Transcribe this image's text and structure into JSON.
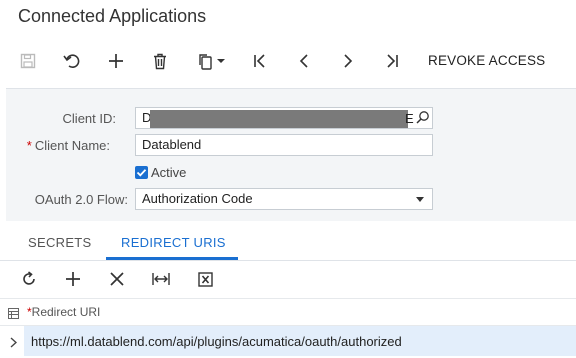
{
  "window": {
    "title": "Connected Applications"
  },
  "toolbar": {
    "save_icon": "save-icon",
    "undo_icon": "undo-icon",
    "add_icon": "plus-icon",
    "delete_icon": "trash-icon",
    "copy_icon": "copy-paste-icon",
    "first_icon": "first-record-icon",
    "prev_icon": "previous-record-icon",
    "next_icon": "next-record-icon",
    "last_icon": "last-record-icon",
    "revoke_label": "REVOKE ACCESS"
  },
  "form": {
    "client_id_label": "Client ID:",
    "client_id_value": "D",
    "client_id_suffix": "E",
    "client_name_label": "Client Name:",
    "client_name_required": "*",
    "client_name_value": "Datablend",
    "active_label": "Active",
    "active_checked": true,
    "oauth_label": "OAuth 2.0 Flow:",
    "oauth_value": "Authorization Code"
  },
  "tabs": [
    {
      "label": "SECRETS",
      "active": false
    },
    {
      "label": "REDIRECT URIS",
      "active": true
    }
  ],
  "grid": {
    "toolbar_icons": [
      "refresh-icon",
      "plus-icon",
      "close-icon",
      "fit-columns-icon",
      "excel-export-icon"
    ],
    "columns": [
      {
        "label": "Redirect URI",
        "required": "*"
      }
    ],
    "rows": [
      {
        "redirect_uri": "https://ml.datablend.com/api/plugins/acumatica/oauth/authorized"
      }
    ]
  },
  "colors": {
    "accent": "#1a6fd1",
    "panel_bg": "#f3f5f7",
    "row_selected": "#e3eefb"
  }
}
